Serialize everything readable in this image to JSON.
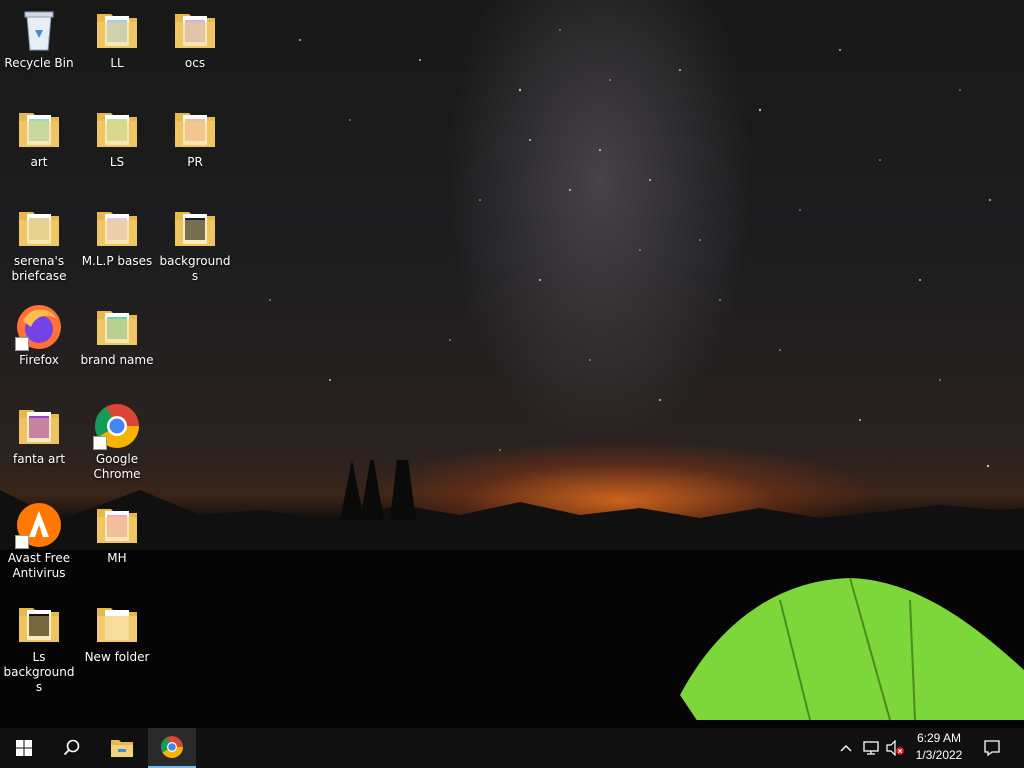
{
  "desktop": {
    "icons": [
      {
        "label": "Recycle Bin",
        "kind": "recycle-bin"
      },
      {
        "label": "LL",
        "kind": "folder"
      },
      {
        "label": "ocs",
        "kind": "folder"
      },
      {
        "label": "art",
        "kind": "folder"
      },
      {
        "label": "LS",
        "kind": "folder"
      },
      {
        "label": "PR",
        "kind": "folder"
      },
      {
        "label": "serena's briefcase",
        "kind": "folder"
      },
      {
        "label": "M.L.P bases",
        "kind": "folder"
      },
      {
        "label": "backgrounds",
        "kind": "folder"
      },
      {
        "label": "Firefox",
        "kind": "firefox"
      },
      {
        "label": "brand name",
        "kind": "folder"
      },
      {
        "label": "fanta art",
        "kind": "folder"
      },
      {
        "label": "Google Chrome",
        "kind": "chrome"
      },
      {
        "label": "Avast Free Antivirus",
        "kind": "avast"
      },
      {
        "label": "MH",
        "kind": "folder"
      },
      {
        "label": "Ls backgrounds",
        "kind": "folder"
      },
      {
        "label": "New folder",
        "kind": "folder"
      }
    ]
  },
  "taskbar": {
    "start_icon": "windows-logo-icon",
    "search_icon": "search-icon",
    "pinned": [
      {
        "name": "file-explorer-icon"
      },
      {
        "name": "chrome-icon"
      }
    ],
    "tray": {
      "clock_time": "6:29 AM",
      "clock_date": "1/3/2022"
    }
  },
  "colors": {
    "taskbar_bg": "#101010",
    "active_underline": "#76b9ed",
    "tent_green": "#7dd63a",
    "folder_yellow": "#f4d27a"
  }
}
